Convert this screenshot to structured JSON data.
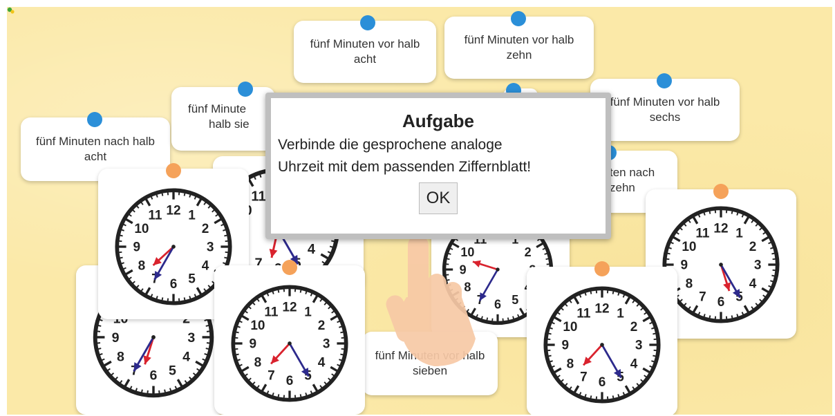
{
  "colors": {
    "background": "#fbe9a8",
    "pin_blue": "#2b8fd8",
    "pin_orange": "#f5a25a",
    "hour_hand": "#d9232e",
    "minute_hand": "#2d2a8c"
  },
  "labels": {
    "l1": "fünf Minuten vor halb acht",
    "l2": "fünf Minuten vor halb zehn",
    "l3": "fünf Minuten vor halb sechs",
    "l4": "fünf Minuten nach halb acht",
    "l5a": "fünf Minute",
    "l5b": "halb sie",
    "l6a": "ten nach",
    "l6b": "zehn",
    "l7": "fünf Minuten vor halb sieben"
  },
  "clock_numbers": [
    "12",
    "1",
    "2",
    "3",
    "4",
    "5",
    "6",
    "7",
    "8",
    "9",
    "10",
    "11"
  ],
  "clocks": [
    {
      "id": "c1",
      "hour": 7,
      "minute": 35
    },
    {
      "id": "c2",
      "hour": 6,
      "minute": 25
    },
    {
      "id": "c3",
      "hour": 9,
      "minute": 35
    },
    {
      "id": "c4",
      "hour": 8,
      "minute": 25
    },
    {
      "id": "c5",
      "hour": 6,
      "minute": 35
    },
    {
      "id": "c6",
      "hour": 7,
      "minute": 25
    },
    {
      "id": "c7",
      "hour": 7,
      "minute": 25
    },
    {
      "id": "c8",
      "hour": 5,
      "minute": 25
    }
  ],
  "dialog": {
    "title": "Aufgabe",
    "line1": "Verbinde die gesprochene analoge",
    "line2": "Uhrzeit mit dem passenden Ziffernblatt!",
    "ok": "OK"
  },
  "icons": {
    "corner": "puzzle-icon",
    "hand": "pointing-hand-icon"
  }
}
